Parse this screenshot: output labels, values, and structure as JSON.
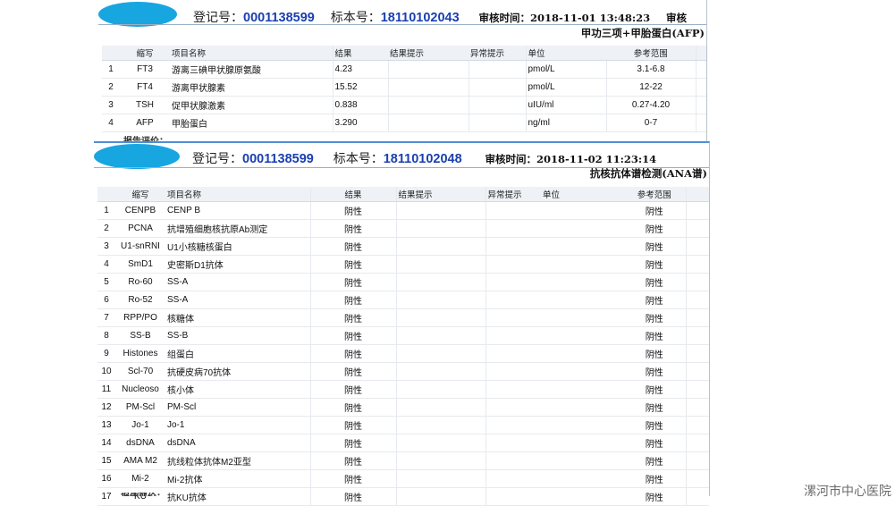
{
  "report1": {
    "reg_label": "登记号：",
    "reg_no": "0001138599",
    "specimen_label": "标本号：",
    "specimen_no": "18110102043",
    "review_label": "审核时间：",
    "review_time": "2018-11-01 13:48:23",
    "review_cut": "审核",
    "subtitle": "甲功三项+甲胎蛋白(AFP)",
    "columns": [
      "缩写",
      "项目名称",
      "结果",
      "结果提示",
      "异常提示",
      "单位",
      "参考范围"
    ],
    "rows": [
      {
        "n": "1",
        "abbr": "FT3",
        "name": "游离三碘甲状腺原氨酸",
        "result": "4.23",
        "unit": "pmol/L",
        "range": "3.1-6.8"
      },
      {
        "n": "2",
        "abbr": "FT4",
        "name": "游离甲状腺素",
        "result": "15.52",
        "unit": "pmol/L",
        "range": "12-22"
      },
      {
        "n": "3",
        "abbr": "TSH",
        "name": "促甲状腺激素",
        "result": "0.838",
        "unit": "uIU/ml",
        "range": "0.27-4.20"
      },
      {
        "n": "4",
        "abbr": "AFP",
        "name": "甲胎蛋白",
        "result": "3.290",
        "unit": "ng/ml",
        "range": "0-7"
      }
    ],
    "footer": "报告评价："
  },
  "report2": {
    "reg_label": "登记号：",
    "reg_no": "0001138599",
    "specimen_label": "标本号：",
    "specimen_no": "18110102048",
    "review_label": "审核时间：",
    "review_time": "2018-11-02 11:23:14",
    "subtitle": "抗核抗体谱检测(ANA谱)",
    "columns": [
      "缩写",
      "项目名称",
      "结果",
      "结果提示",
      "异常提示",
      "单位",
      "参考范围"
    ],
    "rows": [
      {
        "n": "1",
        "abbr": "CENPB",
        "name": "CENP B",
        "result": "阴性",
        "range": "阴性"
      },
      {
        "n": "2",
        "abbr": "PCNA",
        "name": "抗增殖细胞核抗原Ab测定",
        "result": "阴性",
        "range": "阴性"
      },
      {
        "n": "3",
        "abbr": "U1-snRNI",
        "name": "U1小核糖核蛋白",
        "result": "阴性",
        "range": "阴性"
      },
      {
        "n": "4",
        "abbr": "SmD1",
        "name": "史密斯D1抗体",
        "result": "阴性",
        "range": "阴性"
      },
      {
        "n": "5",
        "abbr": "Ro-60",
        "name": "SS-A",
        "result": "阴性",
        "range": "阴性"
      },
      {
        "n": "6",
        "abbr": "Ro-52",
        "name": "SS-A",
        "result": "阴性",
        "range": "阴性"
      },
      {
        "n": "7",
        "abbr": "RPP/PO",
        "name": "核糖体",
        "result": "阴性",
        "range": "阴性"
      },
      {
        "n": "8",
        "abbr": "SS-B",
        "name": "SS-B",
        "result": "阴性",
        "range": "阴性"
      },
      {
        "n": "9",
        "abbr": "Histones",
        "name": "组蛋白",
        "result": "阴性",
        "range": "阴性"
      },
      {
        "n": "10",
        "abbr": "Scl-70",
        "name": "抗硬皮病70抗体",
        "result": "阴性",
        "range": "阴性"
      },
      {
        "n": "11",
        "abbr": "Nucleoso",
        "name": "核小体",
        "result": "阴性",
        "range": "阴性"
      },
      {
        "n": "12",
        "abbr": "PM-Scl",
        "name": "PM-Scl",
        "result": "阴性",
        "range": "阴性"
      },
      {
        "n": "13",
        "abbr": "Jo-1",
        "name": "Jo-1",
        "result": "阴性",
        "range": "阴性"
      },
      {
        "n": "14",
        "abbr": "dsDNA",
        "name": "dsDNA",
        "result": "阴性",
        "range": "阴性"
      },
      {
        "n": "15",
        "abbr": "AMA M2",
        "name": "抗线粒体抗体M2亚型",
        "result": "阴性",
        "range": "阴性"
      },
      {
        "n": "16",
        "abbr": "Mi-2",
        "name": "Mi-2抗体",
        "result": "阴性",
        "range": "阴性"
      },
      {
        "n": "17",
        "abbr": "KU",
        "name": "抗KU抗体",
        "result": "阴性",
        "range": "阴性"
      }
    ]
  },
  "watermark": "漯河市中心医院",
  "colors": {
    "ellipse": "#18a6e0",
    "value_blue": "#1a3fb0"
  }
}
